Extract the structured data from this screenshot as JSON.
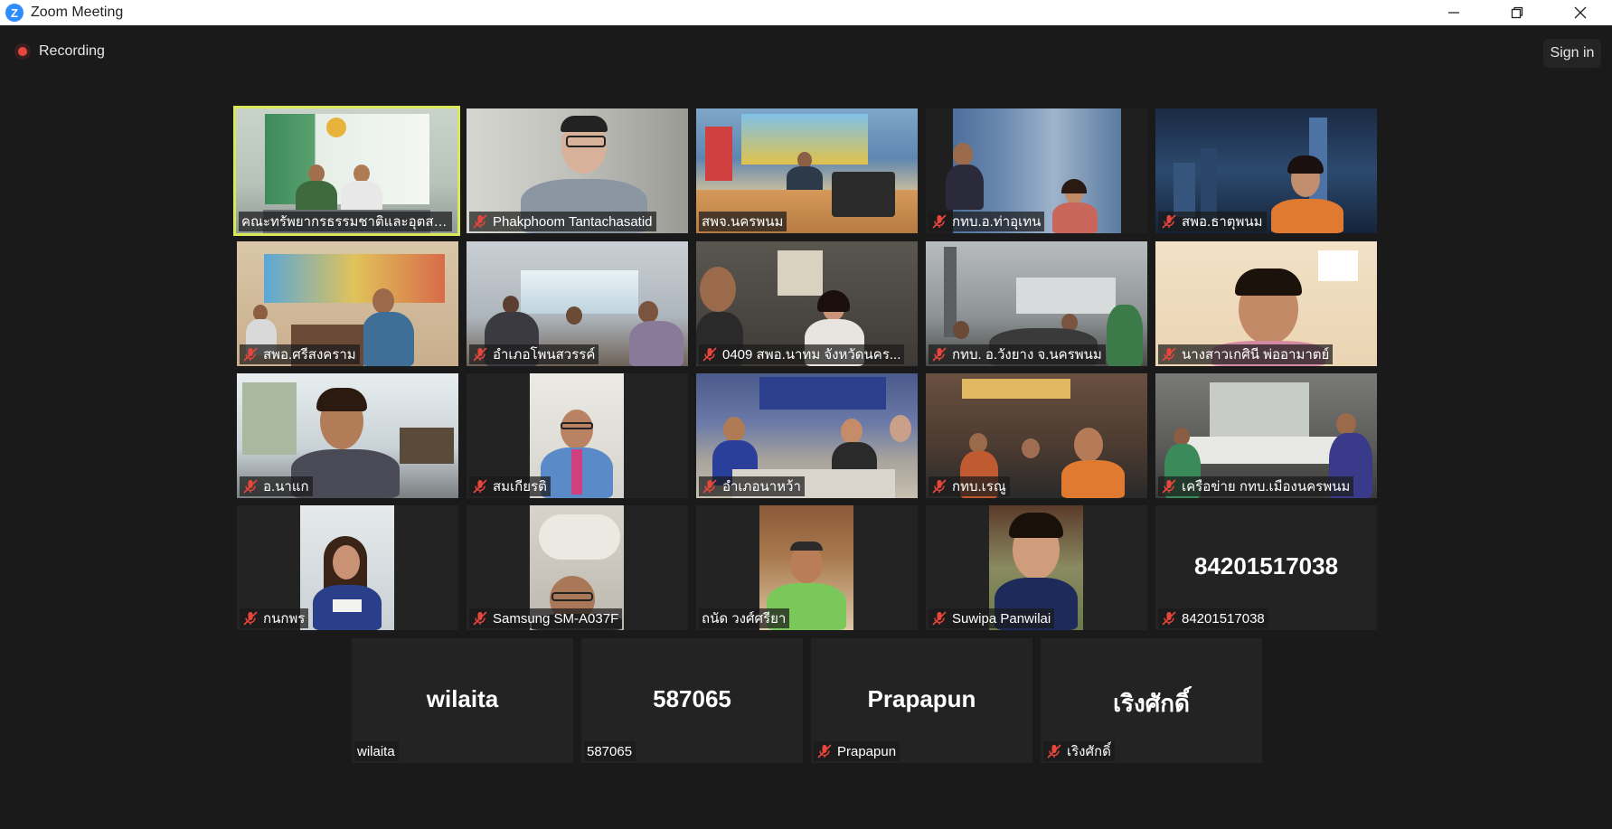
{
  "window": {
    "title": "Zoom Meeting"
  },
  "header": {
    "recording_label": "Recording",
    "signin_label": "Sign in"
  },
  "participants": [
    {
      "name": "คณะทรัพยากรธรรมชาติและอุตสา...",
      "muted": false,
      "video": true,
      "active": true
    },
    {
      "name": "Phakphoom Tantachasatid",
      "muted": true,
      "video": true
    },
    {
      "name": "สพจ.นครพนม",
      "muted": false,
      "video": true
    },
    {
      "name": "กทบ.อ.ท่าอุเทน",
      "muted": true,
      "video": true
    },
    {
      "name": "สพอ.ธาตุพนม",
      "muted": true,
      "video": true
    },
    {
      "name": "สพอ.ศรีสงคราม",
      "muted": true,
      "video": true
    },
    {
      "name": "อำเภอโพนสวรรค์",
      "muted": true,
      "video": true
    },
    {
      "name": "0409 สพอ.นาทม  จังหวัดนคร...",
      "muted": true,
      "video": true
    },
    {
      "name": "กทบ. อ.วังยาง จ.นครพนม",
      "muted": true,
      "video": true
    },
    {
      "name": "นางสาวเกศินี พ่ออามาตย์",
      "muted": true,
      "video": true
    },
    {
      "name": "อ.นาแก",
      "muted": true,
      "video": true
    },
    {
      "name": "สมเกียรติ",
      "muted": true,
      "video": true
    },
    {
      "name": "อำเภอนาหว้า",
      "muted": true,
      "video": true
    },
    {
      "name": "กทบ.เรณู",
      "muted": true,
      "video": true
    },
    {
      "name": "เครือข่าย กทบ.เมืองนครพนม",
      "muted": true,
      "video": true
    },
    {
      "name": "กนกพร",
      "muted": true,
      "video": true
    },
    {
      "name": "Samsung SM-A037F",
      "muted": true,
      "video": true
    },
    {
      "name": "ถนัด วงศ์ศรียา",
      "muted": false,
      "video": true
    },
    {
      "name": "Suwipa Panwilai",
      "muted": true,
      "video": true
    },
    {
      "name": "84201517038",
      "muted": true,
      "video": false,
      "display": "84201517038"
    },
    {
      "name": "wilaita",
      "muted": false,
      "video": false,
      "display": "wilaita"
    },
    {
      "name": "587065",
      "muted": false,
      "video": false,
      "display": "587065"
    },
    {
      "name": "Prapapun",
      "muted": true,
      "video": false,
      "display": "Prapapun"
    },
    {
      "name": "เริงศักดิ์",
      "muted": true,
      "video": false,
      "display": "เริงศักดิ์"
    }
  ],
  "colors": {
    "active_border": "#d8e85a",
    "mute_red": "#e8463c",
    "tile_bg": "#232323",
    "bg": "#1a1a1a"
  }
}
